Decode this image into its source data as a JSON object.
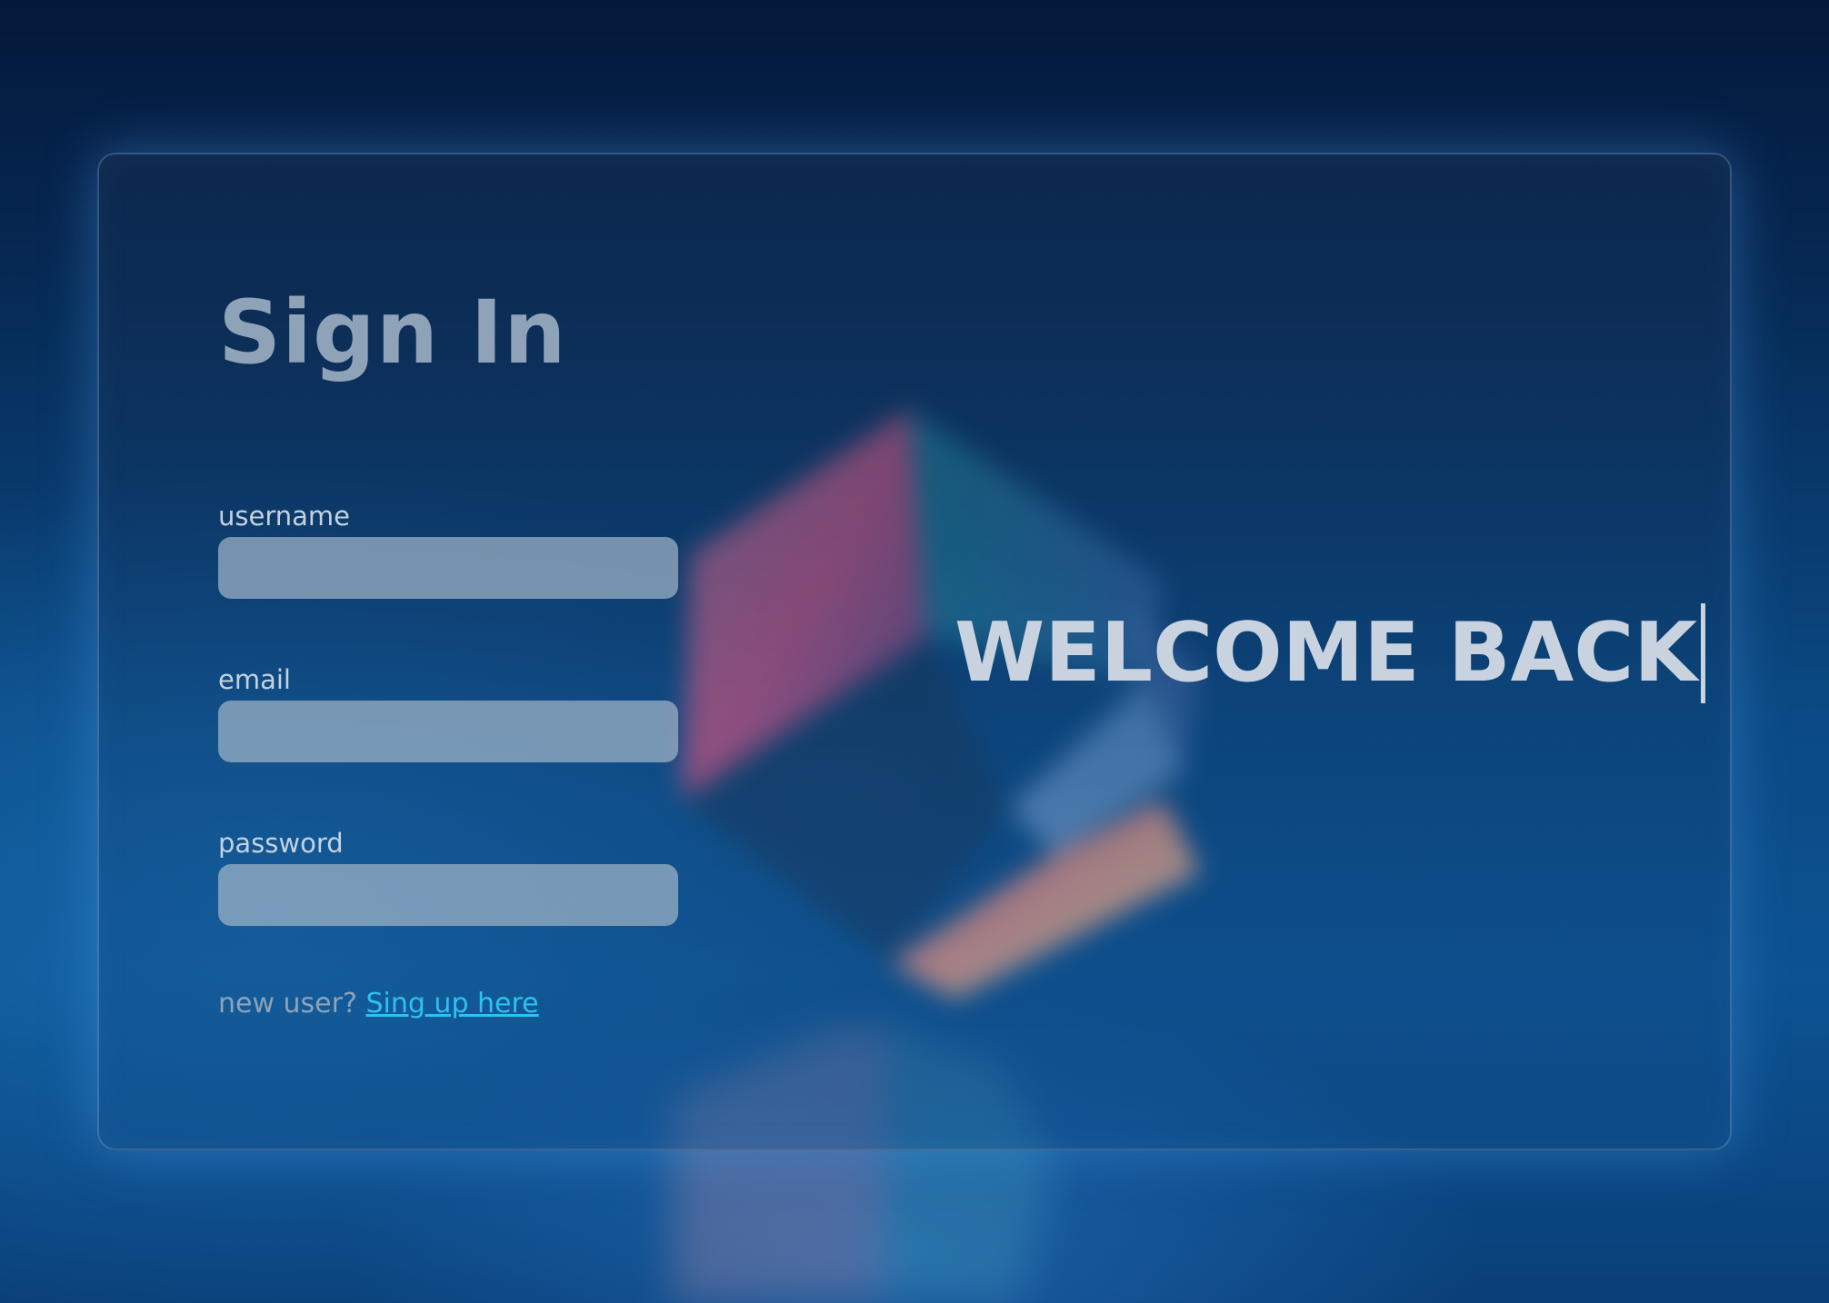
{
  "page": {
    "title": "Sign In",
    "welcome": "WELCOME BACK"
  },
  "form": {
    "fields": [
      {
        "label": "username",
        "value": "",
        "type": "text"
      },
      {
        "label": "email",
        "value": "",
        "type": "email"
      },
      {
        "label": "password",
        "value": "",
        "type": "password"
      }
    ]
  },
  "signup": {
    "prompt": "new user?",
    "link_label": "Sing up here"
  },
  "colors": {
    "link": "#2bc2f2",
    "title": "#8ea2b8",
    "welcome": "#c9d3df",
    "input_fill": "#a0b4c8"
  }
}
